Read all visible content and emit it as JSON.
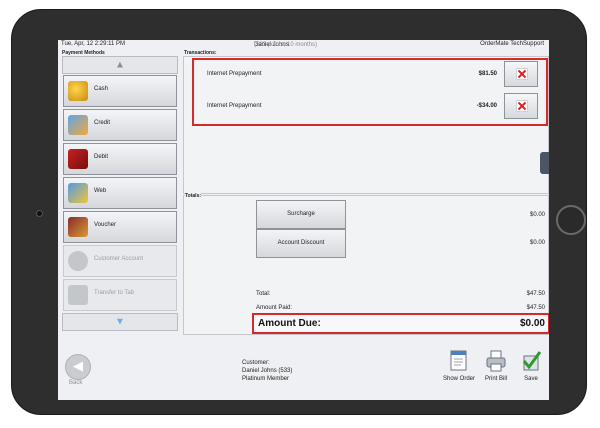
{
  "header": {
    "datetime": "Tue, Apr, 12 2:29:11 PM",
    "customer_name": "Daniel Johns",
    "customer_points": "(533 points, 10 months)",
    "vendor": "OrderMate TechSupport"
  },
  "payment_methods": {
    "title": "Payment Methods",
    "items": [
      {
        "label": "Cash",
        "icon": "cash-icon",
        "enabled": true
      },
      {
        "label": "Credit",
        "icon": "credit-card-icon",
        "enabled": true
      },
      {
        "label": "Debit",
        "icon": "debit-card-icon",
        "enabled": true
      },
      {
        "label": "Web",
        "icon": "web-icon",
        "enabled": true
      },
      {
        "label": "Voucher",
        "icon": "voucher-icon",
        "enabled": true
      },
      {
        "label": "Customer Account",
        "icon": "customer-account-icon",
        "enabled": false
      },
      {
        "label": "Transfer to Tab",
        "icon": "transfer-tab-icon",
        "enabled": false
      }
    ]
  },
  "transactions": {
    "title": "Transactions:",
    "rows": [
      {
        "label": "Internet Prepayment",
        "amount": "$81.50"
      },
      {
        "label": "Internet Prepayment",
        "amount": "-$34.00"
      }
    ]
  },
  "totals": {
    "title": "Totals:",
    "surcharge_label": "Surcharge",
    "surcharge_value": "$0.00",
    "discount_label": "Account Discount",
    "discount_value": "$0.00",
    "total_label": "Total:",
    "total_value": "$47.50",
    "paid_label": "Amount Paid:",
    "paid_value": "$47.50",
    "due_label": "Amount Due:",
    "due_value": "$0.00"
  },
  "footer": {
    "back_label": "Back",
    "customer_heading": "Customer:",
    "customer_line": "Daniel Johns (533)",
    "customer_tier": "Platinum Member",
    "show_order_label": "Show Order",
    "print_bill_label": "Print Bill",
    "save_label": "Save"
  },
  "colors": {
    "highlight": "#d62a2a",
    "tablet_frame": "#2e2e2e",
    "screen_bg": "#eef0f3"
  }
}
